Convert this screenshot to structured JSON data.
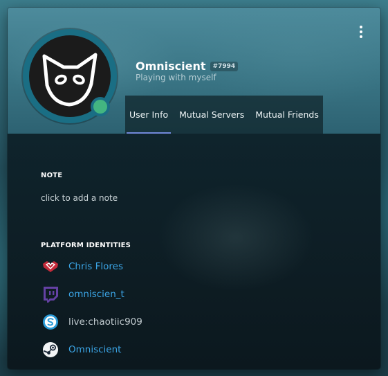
{
  "profile": {
    "username": "Omniscient",
    "discriminator": "#7994",
    "activity": "Playing with myself",
    "status": "online"
  },
  "colors": {
    "status_online": "#43b581",
    "avatar_ring": "#1a6e84",
    "link": "#3ba5e6",
    "tab_indicator": "#7289da"
  },
  "tabs": [
    {
      "label": "User Info",
      "active": true
    },
    {
      "label": "Mutual Servers",
      "active": false
    },
    {
      "label": "Mutual Friends",
      "active": false
    }
  ],
  "note": {
    "title": "NOTE",
    "placeholder": "click to add a note"
  },
  "identities": {
    "title": "PLATFORM IDENTITIES",
    "items": [
      {
        "platform": "battlenet",
        "icon": "battlenet-icon",
        "name": "Chris Flores",
        "link": true
      },
      {
        "platform": "twitch",
        "icon": "twitch-icon",
        "name": "omniscien_t",
        "link": true
      },
      {
        "platform": "skype",
        "icon": "skype-icon",
        "name": "live:chaotiic909",
        "link": false
      },
      {
        "platform": "steam",
        "icon": "steam-icon",
        "name": "Omniscient",
        "link": true
      }
    ]
  }
}
